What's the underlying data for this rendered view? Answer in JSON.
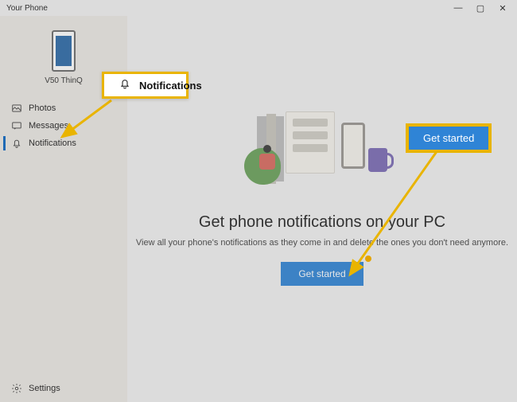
{
  "titlebar": {
    "title": "Your Phone"
  },
  "sidebar": {
    "phone_label": "V50 ThinQ",
    "items": [
      {
        "label": "Photos"
      },
      {
        "label": "Messages"
      },
      {
        "label": "Notifications"
      }
    ],
    "settings_label": "Settings"
  },
  "content": {
    "headline": "Get phone notifications on your PC",
    "subtext": "View all your phone's notifications as they come in and delete the ones you don't need anymore.",
    "cta_label": "Get started"
  },
  "callouts": {
    "notifications_label": "Notifications",
    "get_started_label": "Get started"
  }
}
